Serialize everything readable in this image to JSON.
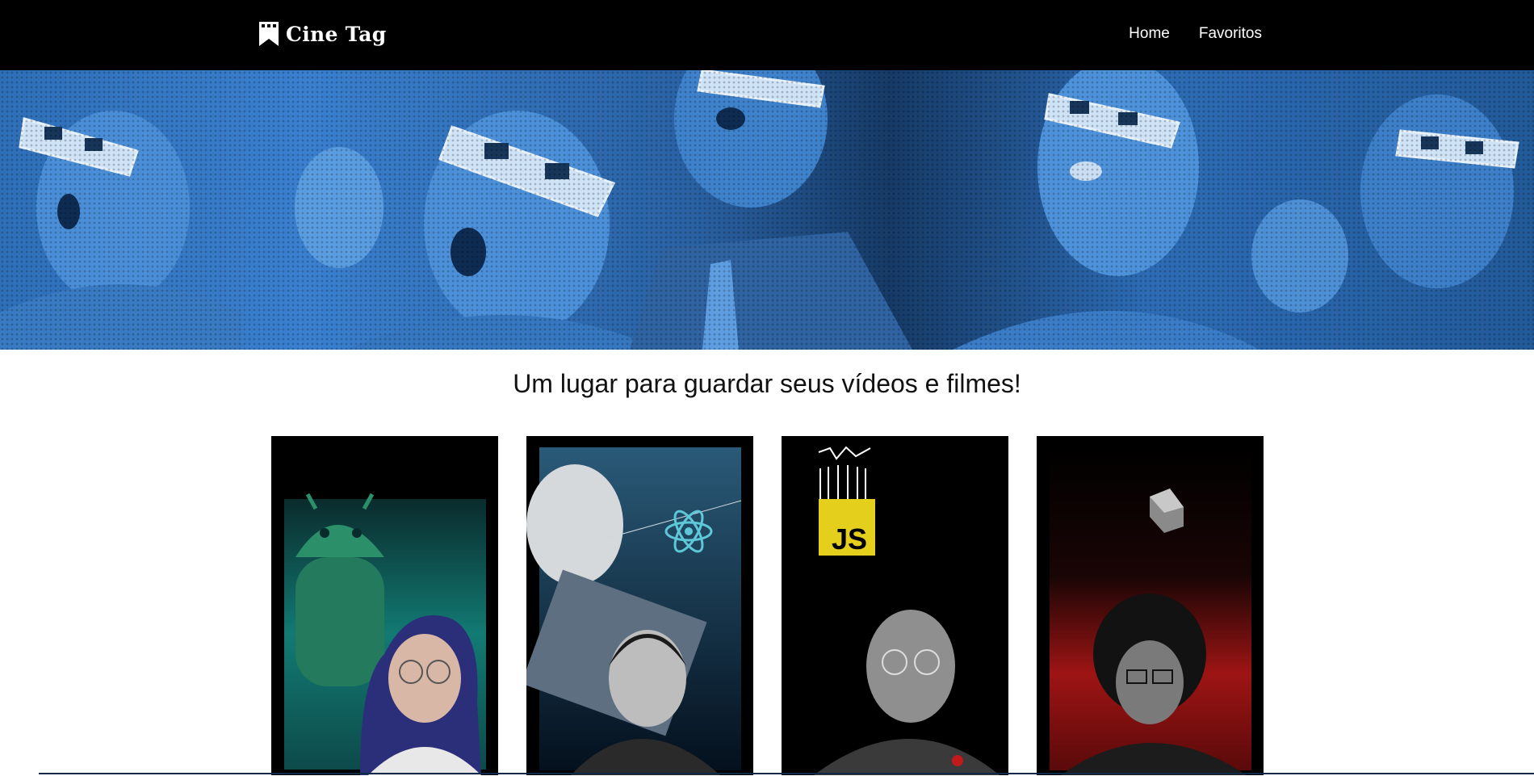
{
  "header": {
    "brand": "Cine Tag",
    "logo_icon": "bookmark-film-icon",
    "nav": [
      {
        "label": "Home"
      },
      {
        "label": "Favoritos"
      }
    ]
  },
  "banner": {
    "description_icon": "cinema-audience-3d-glasses-banner"
  },
  "main": {
    "tagline": "Um lugar para guardar seus vídeos e filmes!"
  },
  "cards": [
    {
      "icon": "android-icon",
      "accent": "#1f8f86",
      "logo_text": ""
    },
    {
      "icon": "react-icon",
      "accent": "#5ec8d8",
      "logo_text": ""
    },
    {
      "icon": "javascript-icon",
      "accent": "#e3cf1c",
      "logo_text": "JS"
    },
    {
      "icon": "dart-icon",
      "accent": "#c21a1a",
      "logo_text": ""
    }
  ],
  "colors": {
    "header_bg": "#000000",
    "banner_blue": "#2f6fb8",
    "text": "#111111"
  }
}
